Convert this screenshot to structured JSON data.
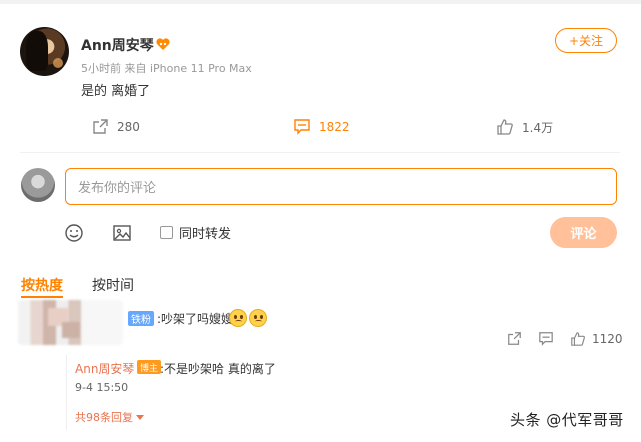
{
  "post": {
    "author": "Ann周安琴",
    "meta": "5小时前  来自 iPhone 11 Pro Max",
    "text": "是的 离婚了",
    "follow_label": "+关注",
    "repost_count": "280",
    "comment_count": "1822",
    "like_count": "1.4万"
  },
  "composer": {
    "placeholder": "发布你的评论",
    "repost_toggle_label": "同时转发",
    "submit_label": "评论"
  },
  "sort_tabs": {
    "hot": "按热度",
    "time": "按时间"
  },
  "comment": {
    "badge": "铁粉",
    "text": ":吵架了吗嫂嫂",
    "like_count": "1120",
    "reply": {
      "author": "Ann周安琴",
      "badge": "博主",
      "text": ":不是吵架哈 真的离了",
      "time": "9-4 15:50"
    },
    "more_replies": "共98条回复"
  },
  "watermark": "头条 @代军哥哥",
  "colors": {
    "accent": "#ff8200",
    "link_name": "#eb7350",
    "fan_badge": "#67a8ff",
    "submit_disabled": "#ffc09a"
  }
}
